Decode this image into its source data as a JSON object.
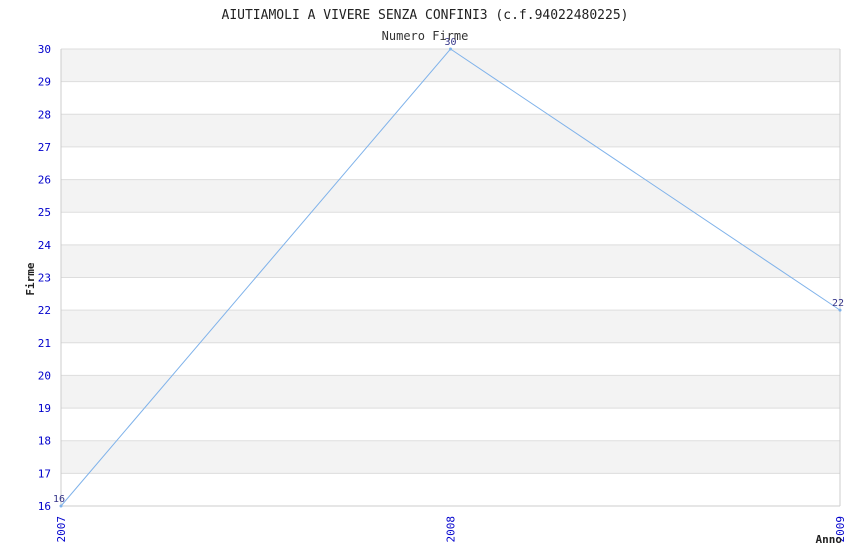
{
  "chart_data": {
    "type": "line",
    "title": "AIUTIAMOLI A VIVERE SENZA CONFINI3 (c.f.94022480225)",
    "subtitle": "Numero Firme",
    "xlabel": "Anno",
    "ylabel": "Firme",
    "categories": [
      "2007",
      "2008",
      "2009"
    ],
    "series": [
      {
        "values": [
          16,
          30,
          22
        ]
      }
    ],
    "ylim": [
      16,
      30
    ],
    "yticks": [
      16,
      17,
      18,
      19,
      20,
      21,
      22,
      23,
      24,
      25,
      26,
      27,
      28,
      29,
      30
    ],
    "grid": true,
    "colors": {
      "line": "#7fb2ea",
      "tick_text": "#0000cc",
      "band": "#f3f3f3",
      "grid": "#dddddd"
    }
  }
}
